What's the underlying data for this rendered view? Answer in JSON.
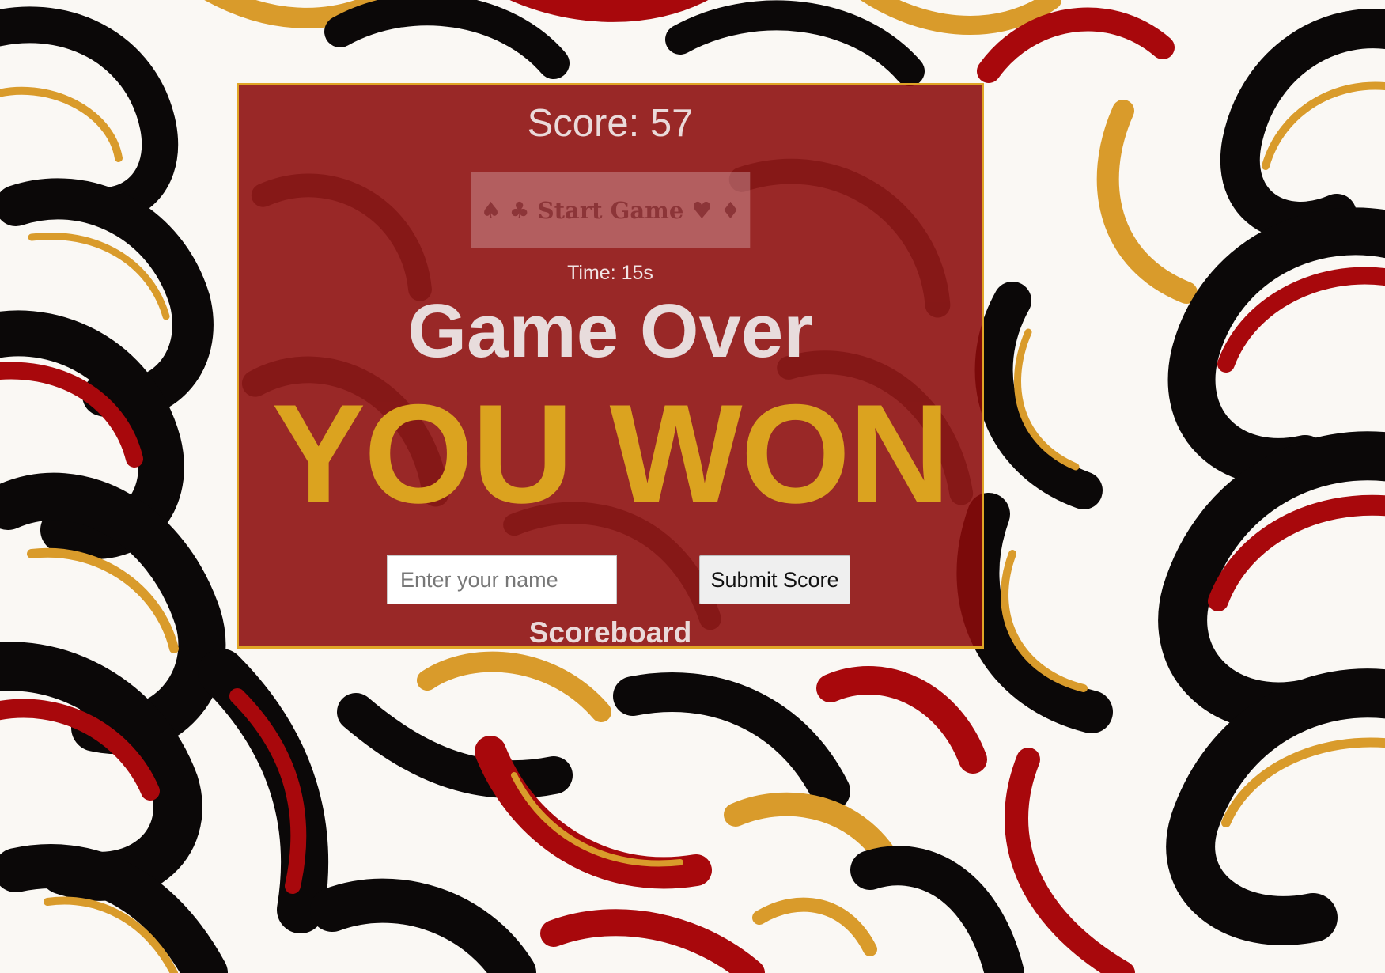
{
  "game": {
    "score_text": "Score: 57",
    "start_button_label": "♠ ♣ Start Game ♥ ♦",
    "timer_text": "Time: 15s",
    "game_over_text": "Game Over",
    "result_text": "YOU WON",
    "name_input": {
      "placeholder": "Enter your name",
      "value": ""
    },
    "submit_button_label": "Submit Score",
    "scoreboard_heading": "Scoreboard"
  },
  "colors": {
    "panel_background": "#8b0a0a",
    "panel_border": "#e0a526",
    "result_gold": "#dba31f",
    "background_red": "#a8080c",
    "background_black": "#0b0808",
    "background_gold": "#d99b2b",
    "background_cream": "#faf8f4"
  },
  "background": {
    "pattern": "baroque-floral-swirls",
    "icons": [
      "spade-icon",
      "club-icon",
      "heart-icon",
      "diamond-icon"
    ]
  }
}
